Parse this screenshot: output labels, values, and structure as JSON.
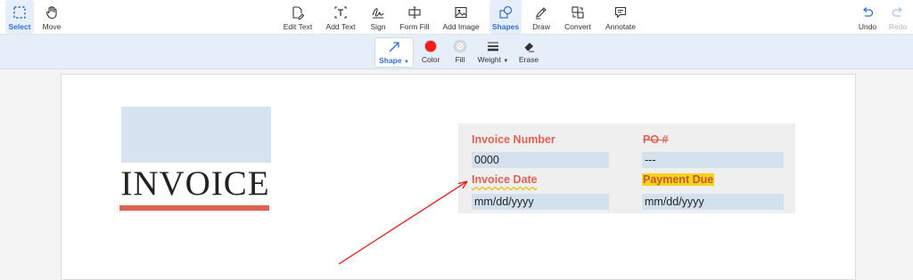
{
  "toolbar": {
    "select": "Select",
    "move": "Move",
    "edit_text": "Edit Text",
    "add_text": "Add Text",
    "sign": "Sign",
    "form_fill": "Form Fill",
    "add_image": "Add Image",
    "shapes": "Shapes",
    "draw": "Draw",
    "convert": "Convert",
    "annotate": "Annotate",
    "undo": "Undo",
    "redo": "Redo"
  },
  "subtoolbar": {
    "shape": "Shape",
    "color": "Color",
    "fill": "Fill",
    "weight": "Weight",
    "erase": "Erase"
  },
  "colors": {
    "accent": "#2f6fd3",
    "shape_color": "#ff1a1a",
    "label_red": "#e06154",
    "highlight": "#f5d21c",
    "field_bg": "#d3e0ee"
  },
  "document": {
    "title": "INVOICE",
    "invoice_number_label": "Invoice Number",
    "invoice_number_value": "0000",
    "po_label": "PO #",
    "po_value": "---",
    "invoice_date_label": "Invoice Date",
    "invoice_date_value": "mm/dd/yyyy",
    "payment_due_label": "Payment Due",
    "payment_due_value": "mm/dd/yyyy"
  }
}
